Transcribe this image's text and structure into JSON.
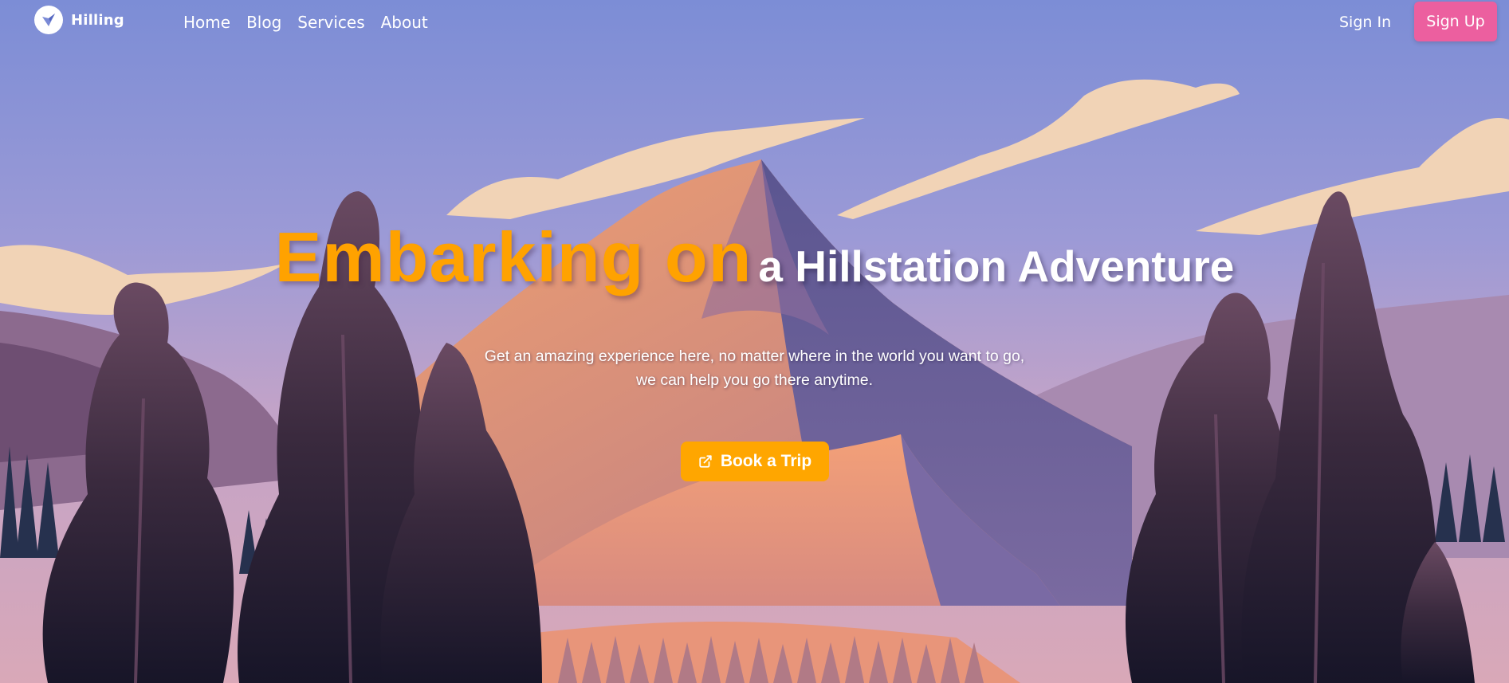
{
  "nav": {
    "brand": "Hilling",
    "links": [
      "Home",
      "Blog",
      "Services",
      "About"
    ],
    "sign_in": "Sign In",
    "sign_up": "Sign Up"
  },
  "hero": {
    "headline_accent": "Embarking on",
    "headline_rest": "a Hillstation Adventure",
    "subtitle_line1": "Get an amazing experience here, no matter where in the world you want to go,",
    "subtitle_line2": "we can help you go there anytime.",
    "cta_label": "Book a Trip",
    "cta_icon": "external-link-icon"
  },
  "colors": {
    "accent": "#ffa200",
    "signup": "#ec5f9f",
    "sky": "#7f8dd6"
  }
}
